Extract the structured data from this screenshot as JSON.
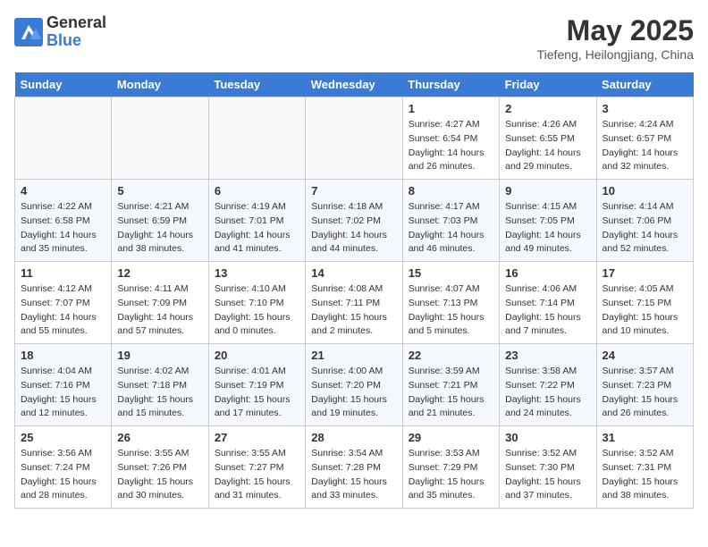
{
  "logo": {
    "general": "General",
    "blue": "Blue"
  },
  "title": {
    "month_year": "May 2025",
    "location": "Tiefeng, Heilongjiang, China"
  },
  "days_of_week": [
    "Sunday",
    "Monday",
    "Tuesday",
    "Wednesday",
    "Thursday",
    "Friday",
    "Saturday"
  ],
  "weeks": [
    [
      {
        "day": "",
        "info": ""
      },
      {
        "day": "",
        "info": ""
      },
      {
        "day": "",
        "info": ""
      },
      {
        "day": "",
        "info": ""
      },
      {
        "day": "1",
        "info": "Sunrise: 4:27 AM\nSunset: 6:54 PM\nDaylight: 14 hours\nand 26 minutes."
      },
      {
        "day": "2",
        "info": "Sunrise: 4:26 AM\nSunset: 6:55 PM\nDaylight: 14 hours\nand 29 minutes."
      },
      {
        "day": "3",
        "info": "Sunrise: 4:24 AM\nSunset: 6:57 PM\nDaylight: 14 hours\nand 32 minutes."
      }
    ],
    [
      {
        "day": "4",
        "info": "Sunrise: 4:22 AM\nSunset: 6:58 PM\nDaylight: 14 hours\nand 35 minutes."
      },
      {
        "day": "5",
        "info": "Sunrise: 4:21 AM\nSunset: 6:59 PM\nDaylight: 14 hours\nand 38 minutes."
      },
      {
        "day": "6",
        "info": "Sunrise: 4:19 AM\nSunset: 7:01 PM\nDaylight: 14 hours\nand 41 minutes."
      },
      {
        "day": "7",
        "info": "Sunrise: 4:18 AM\nSunset: 7:02 PM\nDaylight: 14 hours\nand 44 minutes."
      },
      {
        "day": "8",
        "info": "Sunrise: 4:17 AM\nSunset: 7:03 PM\nDaylight: 14 hours\nand 46 minutes."
      },
      {
        "day": "9",
        "info": "Sunrise: 4:15 AM\nSunset: 7:05 PM\nDaylight: 14 hours\nand 49 minutes."
      },
      {
        "day": "10",
        "info": "Sunrise: 4:14 AM\nSunset: 7:06 PM\nDaylight: 14 hours\nand 52 minutes."
      }
    ],
    [
      {
        "day": "11",
        "info": "Sunrise: 4:12 AM\nSunset: 7:07 PM\nDaylight: 14 hours\nand 55 minutes."
      },
      {
        "day": "12",
        "info": "Sunrise: 4:11 AM\nSunset: 7:09 PM\nDaylight: 14 hours\nand 57 minutes."
      },
      {
        "day": "13",
        "info": "Sunrise: 4:10 AM\nSunset: 7:10 PM\nDaylight: 15 hours\nand 0 minutes."
      },
      {
        "day": "14",
        "info": "Sunrise: 4:08 AM\nSunset: 7:11 PM\nDaylight: 15 hours\nand 2 minutes."
      },
      {
        "day": "15",
        "info": "Sunrise: 4:07 AM\nSunset: 7:13 PM\nDaylight: 15 hours\nand 5 minutes."
      },
      {
        "day": "16",
        "info": "Sunrise: 4:06 AM\nSunset: 7:14 PM\nDaylight: 15 hours\nand 7 minutes."
      },
      {
        "day": "17",
        "info": "Sunrise: 4:05 AM\nSunset: 7:15 PM\nDaylight: 15 hours\nand 10 minutes."
      }
    ],
    [
      {
        "day": "18",
        "info": "Sunrise: 4:04 AM\nSunset: 7:16 PM\nDaylight: 15 hours\nand 12 minutes."
      },
      {
        "day": "19",
        "info": "Sunrise: 4:02 AM\nSunset: 7:18 PM\nDaylight: 15 hours\nand 15 minutes."
      },
      {
        "day": "20",
        "info": "Sunrise: 4:01 AM\nSunset: 7:19 PM\nDaylight: 15 hours\nand 17 minutes."
      },
      {
        "day": "21",
        "info": "Sunrise: 4:00 AM\nSunset: 7:20 PM\nDaylight: 15 hours\nand 19 minutes."
      },
      {
        "day": "22",
        "info": "Sunrise: 3:59 AM\nSunset: 7:21 PM\nDaylight: 15 hours\nand 21 minutes."
      },
      {
        "day": "23",
        "info": "Sunrise: 3:58 AM\nSunset: 7:22 PM\nDaylight: 15 hours\nand 24 minutes."
      },
      {
        "day": "24",
        "info": "Sunrise: 3:57 AM\nSunset: 7:23 PM\nDaylight: 15 hours\nand 26 minutes."
      }
    ],
    [
      {
        "day": "25",
        "info": "Sunrise: 3:56 AM\nSunset: 7:24 PM\nDaylight: 15 hours\nand 28 minutes."
      },
      {
        "day": "26",
        "info": "Sunrise: 3:55 AM\nSunset: 7:26 PM\nDaylight: 15 hours\nand 30 minutes."
      },
      {
        "day": "27",
        "info": "Sunrise: 3:55 AM\nSunset: 7:27 PM\nDaylight: 15 hours\nand 31 minutes."
      },
      {
        "day": "28",
        "info": "Sunrise: 3:54 AM\nSunset: 7:28 PM\nDaylight: 15 hours\nand 33 minutes."
      },
      {
        "day": "29",
        "info": "Sunrise: 3:53 AM\nSunset: 7:29 PM\nDaylight: 15 hours\nand 35 minutes."
      },
      {
        "day": "30",
        "info": "Sunrise: 3:52 AM\nSunset: 7:30 PM\nDaylight: 15 hours\nand 37 minutes."
      },
      {
        "day": "31",
        "info": "Sunrise: 3:52 AM\nSunset: 7:31 PM\nDaylight: 15 hours\nand 38 minutes."
      }
    ]
  ]
}
